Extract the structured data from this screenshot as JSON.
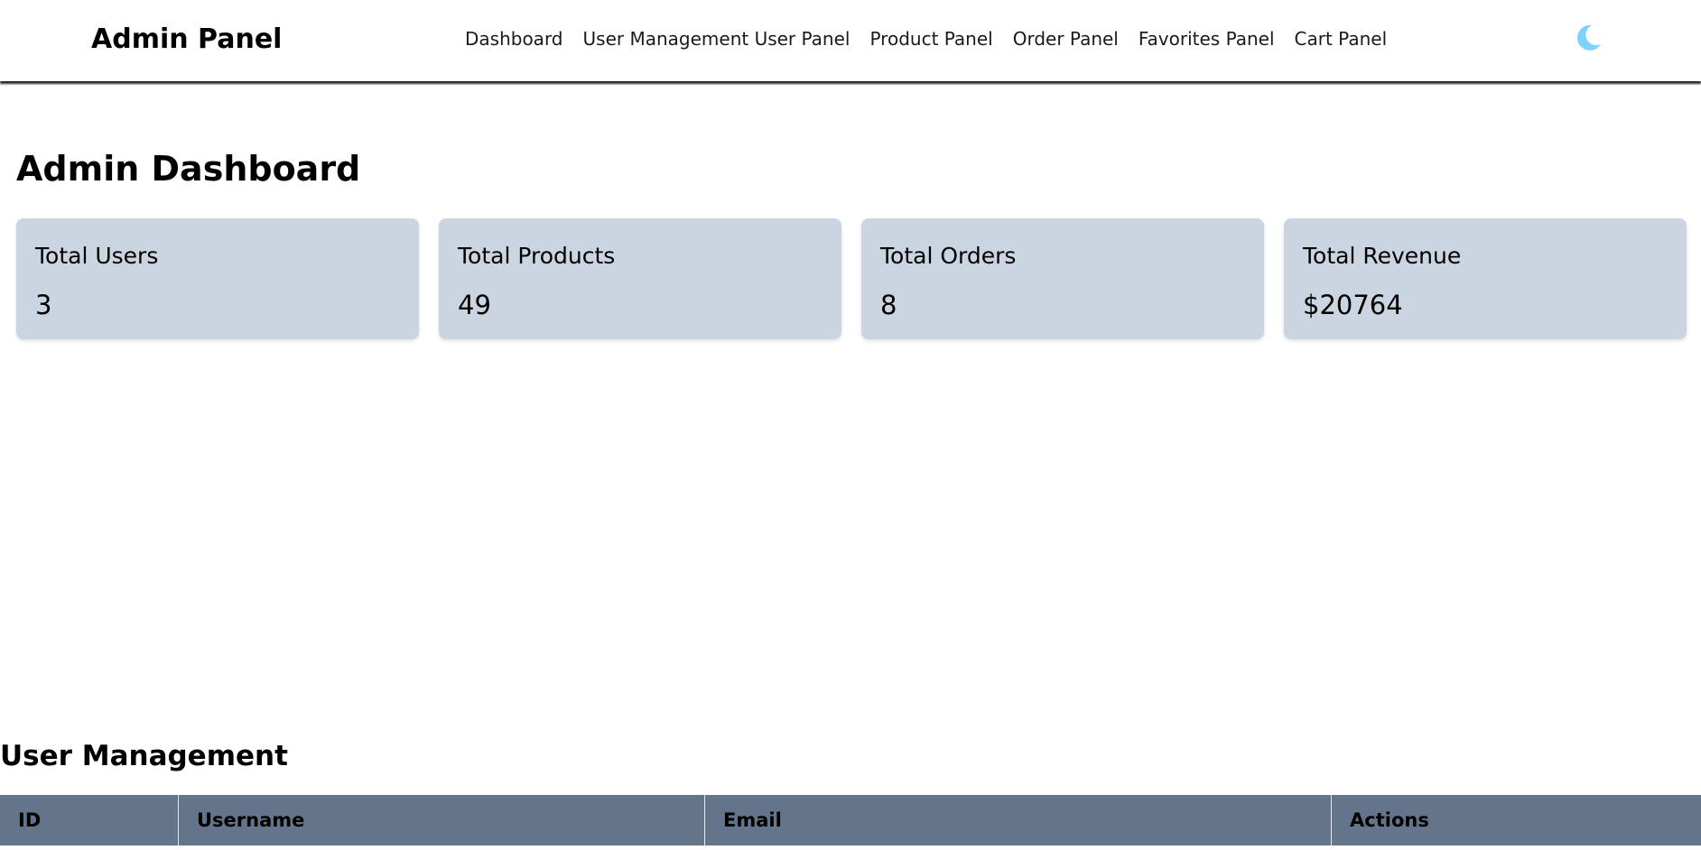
{
  "navbar": {
    "brand": "Admin Panel",
    "links": [
      "Dashboard",
      "User Management User Panel",
      "Product Panel",
      "Order Panel",
      "Favorites Panel",
      "Cart Panel"
    ],
    "theme_icon": "moon-icon",
    "theme_icon_color": "#7dd3fc"
  },
  "dashboard": {
    "title": "Admin Dashboard",
    "cards": [
      {
        "label": "Total Users",
        "value": "3"
      },
      {
        "label": "Total Products",
        "value": "49"
      },
      {
        "label": "Total Orders",
        "value": "8"
      },
      {
        "label": "Total Revenue",
        "value": "$20764"
      }
    ],
    "card_color": "#cbd5e1"
  },
  "user_management": {
    "title": "User Management",
    "columns": [
      "ID",
      "Username",
      "Email",
      "Actions"
    ],
    "header_color": "#64748b"
  }
}
